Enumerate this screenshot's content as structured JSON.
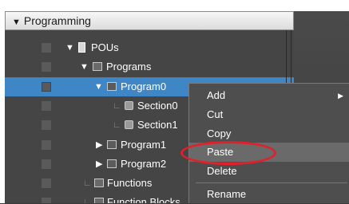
{
  "tree": {
    "header": "Programming",
    "items": [
      {
        "label": "POUs"
      },
      {
        "label": "Programs"
      },
      {
        "label": "Program0"
      },
      {
        "label": "Section0"
      },
      {
        "label": "Section1"
      },
      {
        "label": "Program1"
      },
      {
        "label": "Program2"
      },
      {
        "label": "Functions"
      },
      {
        "label": "Function Blocks"
      }
    ]
  },
  "context_menu": {
    "items": [
      {
        "label": "Add"
      },
      {
        "label": "Cut"
      },
      {
        "label": "Copy"
      },
      {
        "label": "Paste"
      },
      {
        "label": "Delete"
      },
      {
        "label": "Rename"
      }
    ]
  },
  "colors": {
    "selection": "#3f86c6",
    "highlight_ring": "#e0202a"
  }
}
